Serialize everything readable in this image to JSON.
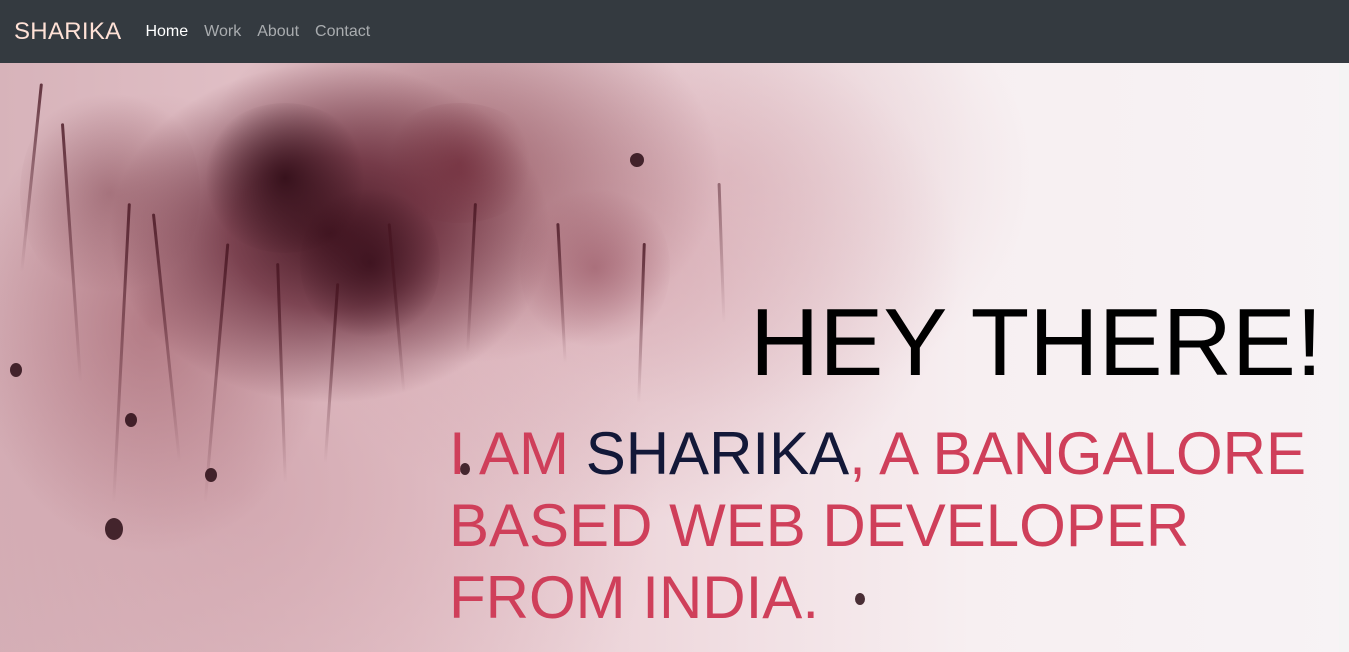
{
  "navbar": {
    "brand": "SHARIKA",
    "links": [
      {
        "label": "Home",
        "active": true
      },
      {
        "label": "Work",
        "active": false
      },
      {
        "label": "About",
        "active": false
      },
      {
        "label": "Contact",
        "active": false
      }
    ]
  },
  "hero": {
    "heading": "HEY THERE!",
    "intro_prefix": "I AM ",
    "name": "SHARIKA",
    "intro_suffix": ", A BANGALORE BASED WEB DEVELOPER FROM INDIA."
  },
  "colors": {
    "navbar_bg": "#343a40",
    "brand": "#ffe1d6",
    "accent": "#cf3f5a",
    "name_highlight": "#131838",
    "heading": "#000000"
  }
}
